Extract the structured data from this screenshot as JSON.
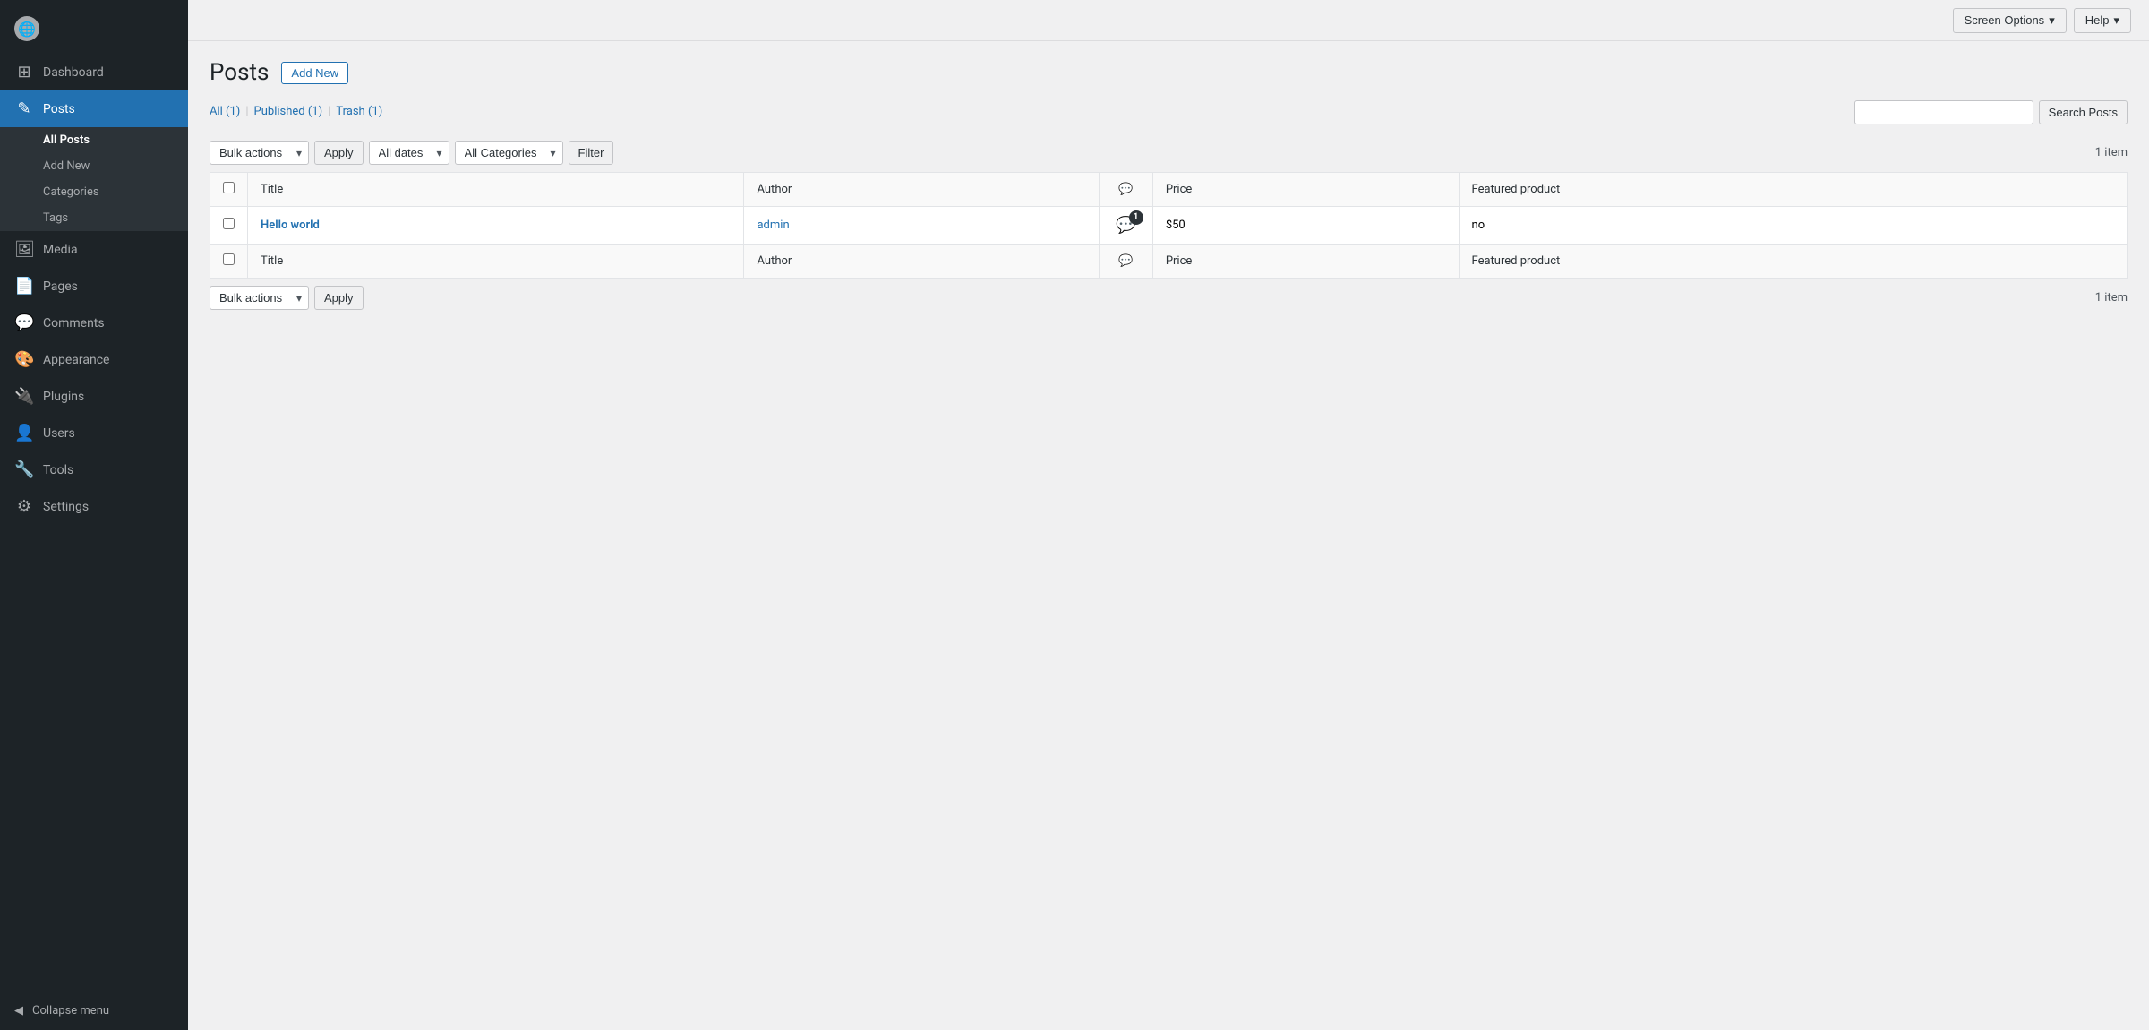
{
  "sidebar": {
    "logo": {
      "icon": "🌐",
      "label": ""
    },
    "items": [
      {
        "id": "dashboard",
        "icon": "⊞",
        "label": "Dashboard",
        "active": false
      },
      {
        "id": "posts",
        "icon": "✎",
        "label": "Posts",
        "active": true
      },
      {
        "id": "media",
        "icon": "🖼",
        "label": "Media",
        "active": false
      },
      {
        "id": "pages",
        "icon": "📄",
        "label": "Pages",
        "active": false
      },
      {
        "id": "comments",
        "icon": "💬",
        "label": "Comments",
        "active": false
      },
      {
        "id": "appearance",
        "icon": "🎨",
        "label": "Appearance",
        "active": false
      },
      {
        "id": "plugins",
        "icon": "🔌",
        "label": "Plugins",
        "active": false
      },
      {
        "id": "users",
        "icon": "👤",
        "label": "Users",
        "active": false
      },
      {
        "id": "tools",
        "icon": "🔧",
        "label": "Tools",
        "active": false
      },
      {
        "id": "settings",
        "icon": "⚙",
        "label": "Settings",
        "active": false
      }
    ],
    "posts_submenu": [
      {
        "id": "all-posts",
        "label": "All Posts",
        "active": true
      },
      {
        "id": "add-new",
        "label": "Add New",
        "active": false
      },
      {
        "id": "categories",
        "label": "Categories",
        "active": false
      },
      {
        "id": "tags",
        "label": "Tags",
        "active": false
      }
    ],
    "collapse_label": "Collapse menu"
  },
  "topbar": {
    "screen_options_label": "Screen Options",
    "help_label": "Help"
  },
  "page": {
    "title": "Posts",
    "add_new_label": "Add New"
  },
  "filter_tabs": {
    "all_label": "All",
    "all_count": "(1)",
    "published_label": "Published",
    "published_count": "(1)",
    "trash_label": "Trash",
    "trash_count": "(1)",
    "sep1": "|",
    "sep2": "|"
  },
  "top_filter": {
    "bulk_actions_label": "Bulk actions",
    "apply_label": "Apply",
    "all_dates_label": "All dates",
    "all_categories_label": "All Categories",
    "filter_label": "Filter",
    "items_count": "1 item"
  },
  "search": {
    "placeholder": "",
    "search_label": "Search Posts"
  },
  "table": {
    "headers": [
      {
        "id": "title",
        "label": "Title"
      },
      {
        "id": "author",
        "label": "Author"
      },
      {
        "id": "comments",
        "label": "💬"
      },
      {
        "id": "price",
        "label": "Price"
      },
      {
        "id": "featured",
        "label": "Featured product"
      }
    ],
    "rows": [
      {
        "id": "1",
        "title": "Hello world",
        "author": "admin",
        "comments_count": "1",
        "has_badge": true,
        "price": "$50",
        "featured": "no"
      }
    ]
  },
  "bottom_filter": {
    "bulk_actions_label": "Bulk actions",
    "apply_label": "Apply",
    "items_count": "1 item"
  }
}
